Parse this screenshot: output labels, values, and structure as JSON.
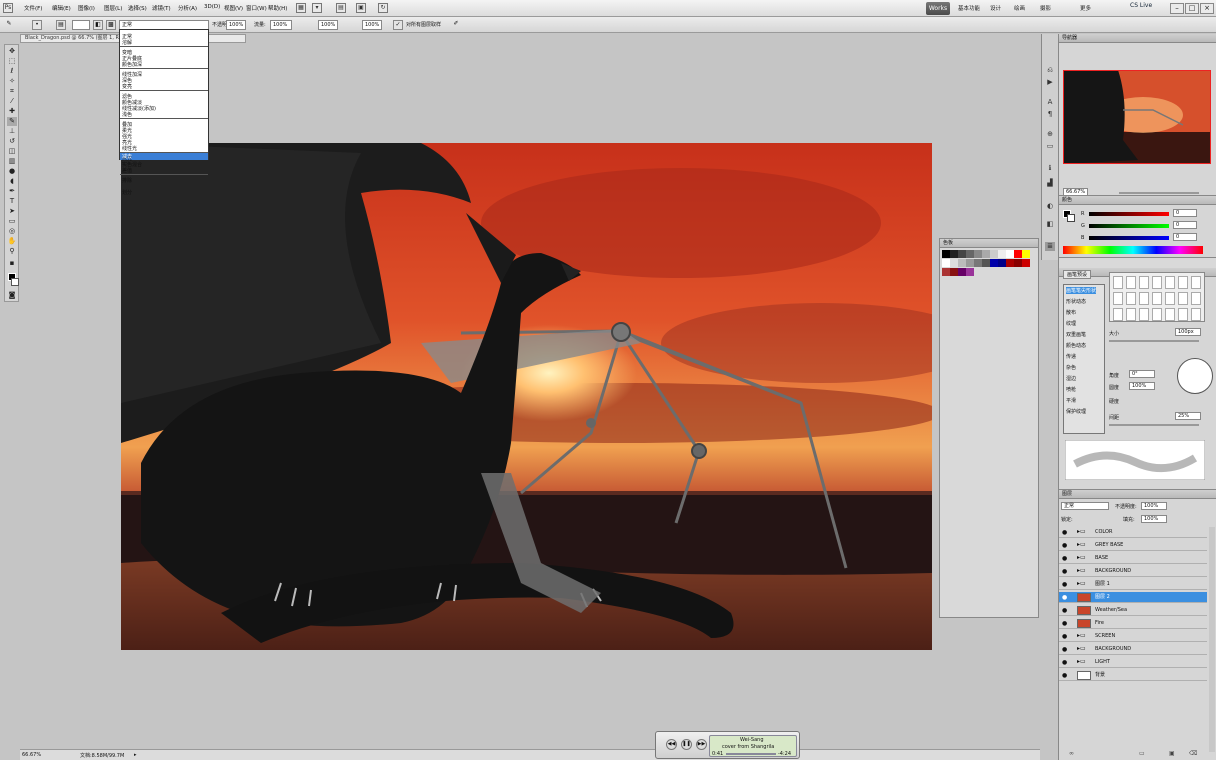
{
  "menubar": {
    "items": [
      "文件(F)",
      "编辑(E)",
      "图像(I)",
      "图层(L)",
      "选择(S)",
      "滤镜(T)",
      "分析(A)",
      "3D(D)",
      "视图(V)",
      "窗口(W)",
      "帮助(H)"
    ],
    "workspace": "Works",
    "workspace_items": [
      "基本功能",
      "设计",
      "绘画",
      "摄影",
      "更多",
      "CS Live"
    ],
    "controls": [
      "–",
      "□",
      "×"
    ]
  },
  "options": {
    "brush_size": "",
    "mode_value": "正常",
    "opacity_label": "不透明度:",
    "opacity": "100%",
    "flow_label": "流量:",
    "flow": "100%",
    "extra1": "100%",
    "extra2": "100%",
    "sample_label": "对所有图层取样"
  },
  "dropdown": {
    "items": [
      "正常",
      "溶解",
      "变暗",
      "正片叠底",
      "颜色加深",
      "线性加深",
      "深色",
      "变亮",
      "滤色",
      "颜色减淡",
      "线性减淡(添加)",
      "浅色",
      "叠加",
      "柔光",
      "强光",
      "亮光",
      "线性光",
      "点光",
      "实色混合",
      "差值",
      "排除",
      "减去",
      "划分"
    ],
    "selected": "减去"
  },
  "document": {
    "tab": "Black_Dragon.psd @ 66.7% (图层 1, RGB/8) *"
  },
  "status": {
    "zoom": "66.67%",
    "doc": "文档:8.58M/99.7M"
  },
  "swatches": {
    "title": "色板"
  },
  "navigator": {
    "title": "导航器",
    "zoom": "66.67%"
  },
  "color": {
    "title": "颜色",
    "r_label": "R",
    "g_label": "G",
    "b_label": "B",
    "r": "0",
    "g": "0",
    "b": "0"
  },
  "brush": {
    "title": "画笔预设",
    "items": [
      "画笔笔尖形状",
      "形状动态",
      "散布",
      "纹理",
      "双重画笔",
      "颜色动态",
      "传递",
      "杂色",
      "湿边",
      "喷枪",
      "平滑",
      "保护纹理"
    ],
    "size_label": "大小",
    "size": "100px",
    "angle_label": "角度",
    "angle": "0°",
    "round_label": "圆度",
    "roundness": "100%",
    "hardness_label": "硬度",
    "spacing_label": "间距",
    "spacing": "25%"
  },
  "layers": {
    "title": "图层",
    "blend": "正常",
    "opacity_label": "不透明度:",
    "opacity": "100%",
    "lock_label": "锁定:",
    "fill_label": "填充:",
    "fill": "100%",
    "rows": [
      "COLOR",
      "GREY BASE",
      "BASE",
      "BACKGROUND",
      "图层 1",
      "图层 2",
      "Weather/Sea",
      "Fire",
      "SCREEN",
      "BACKGROUND",
      "LIGHT",
      "背景"
    ],
    "selected_index": 5
  },
  "media": {
    "title": "Wei-Sang",
    "subtitle": "cover from Shangrila",
    "time_left": "0:41",
    "time_right": "-4:24"
  }
}
